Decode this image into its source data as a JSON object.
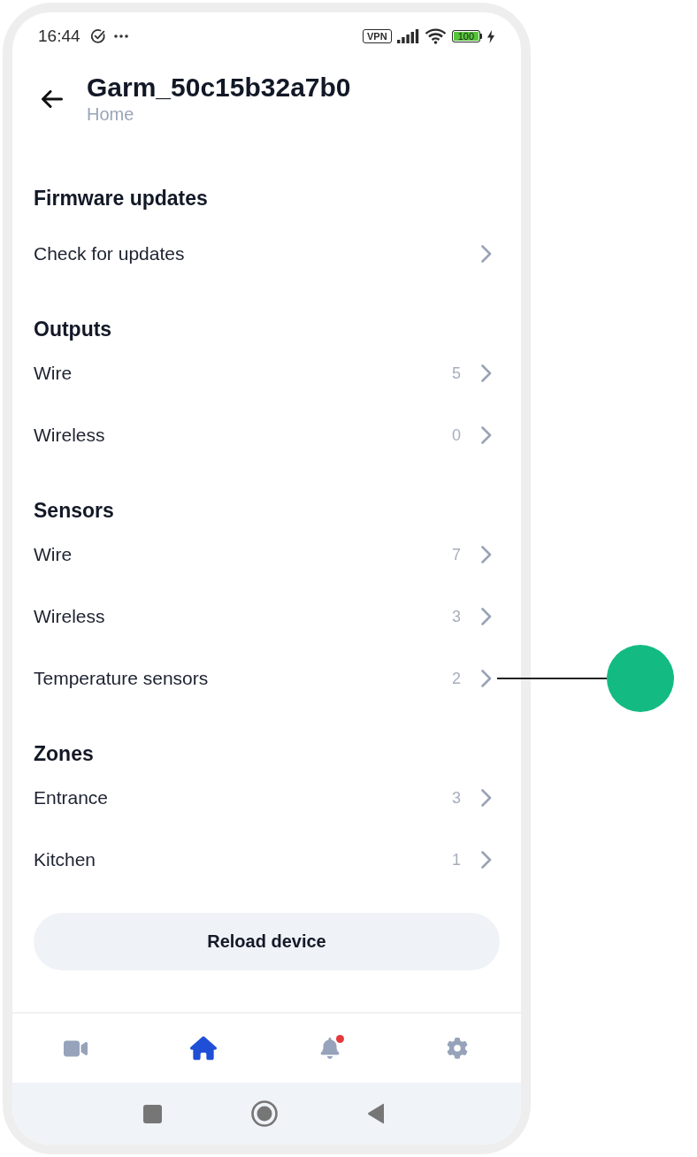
{
  "status_bar": {
    "time": "16:44",
    "vpn": "VPN",
    "battery": "100"
  },
  "header": {
    "title": "Garm_50c15b32a7b0",
    "subtitle": "Home"
  },
  "sections": [
    {
      "title": "Firmware updates",
      "items": [
        {
          "label": "Check for updates",
          "marked": false
        }
      ]
    },
    {
      "title": "Outputs",
      "items": [
        {
          "label": "Wire",
          "count": "5",
          "marked": false
        },
        {
          "label": "Wireless",
          "count": "0",
          "marked": false
        }
      ]
    },
    {
      "title": "Sensors",
      "items": [
        {
          "label": "Wire",
          "count": "7",
          "marked": false
        },
        {
          "label": "Wireless",
          "count": "3",
          "marked": false
        },
        {
          "label": "Temperature sensors",
          "count": "2",
          "marked": true
        }
      ]
    },
    {
      "title": "Zones",
      "items": [
        {
          "label": "Entrance",
          "count": "3",
          "marked": false
        },
        {
          "label": "Kitchen",
          "count": "1",
          "marked": false
        }
      ]
    }
  ],
  "reload_button": {
    "label": "Reload device"
  },
  "bottom_nav": [
    {
      "kind": "camera",
      "selected": false,
      "badge": false
    },
    {
      "kind": "home",
      "selected": true,
      "badge": false
    },
    {
      "kind": "bell",
      "selected": false,
      "badge": true
    },
    {
      "kind": "gear",
      "selected": false,
      "badge": false
    }
  ]
}
